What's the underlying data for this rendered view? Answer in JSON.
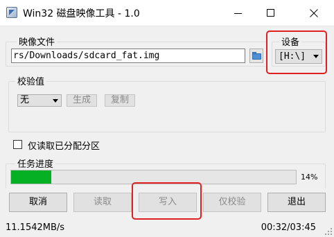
{
  "window": {
    "title": "Win32 磁盘映像工具 - 1.0"
  },
  "image_file": {
    "legend": "映像文件",
    "path": "rs/Downloads/sdcard_fat.img"
  },
  "device": {
    "legend": "设备",
    "selected": "[H:\\]"
  },
  "hash": {
    "legend": "校验值",
    "selected": "无",
    "generate_label": "生成",
    "copy_label": "复制"
  },
  "read_only": {
    "label": "仅读取已分配分区",
    "checked": false
  },
  "progress": {
    "legend": "任务进度",
    "percent": 14,
    "percent_label": "14%",
    "fill_color": "#06b025"
  },
  "actions": {
    "cancel": "取消",
    "read": "读取",
    "write": "写入",
    "verify": "仅校验",
    "exit": "退出"
  },
  "status": {
    "speed": "11.1542MB/s",
    "time": "00:32/03:45"
  },
  "highlight_color": "#e02020"
}
